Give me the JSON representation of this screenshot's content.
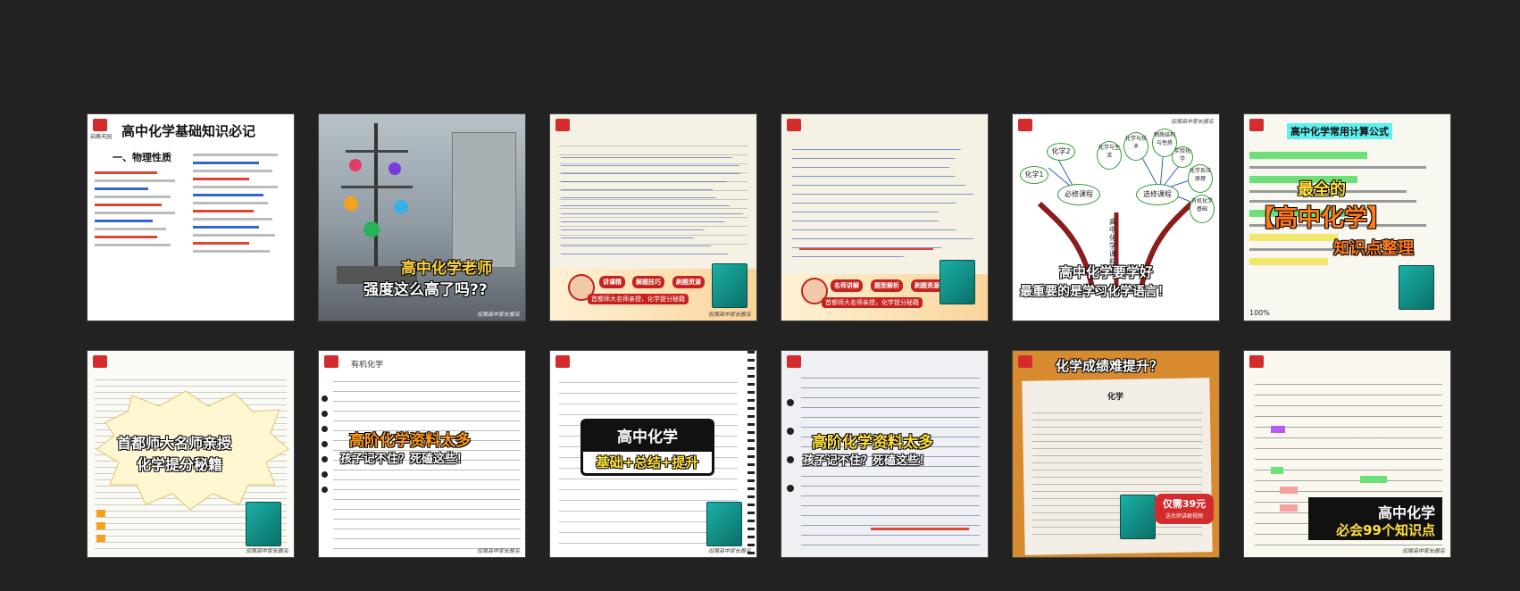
{
  "thumbnails": [
    {
      "title": "高中化学基础知识必记",
      "subtitle": "一、物理性质",
      "brand": "启峰天园"
    },
    {
      "overlay_line1": "高中化学老师",
      "overlay_line2": "强度这么高了吗??",
      "footer": "仅限高中家长报名"
    },
    {
      "tags": [
        "讲课精",
        "解题技巧",
        "刷题资源"
      ],
      "promo_line": "首都师大名师亲授，化学提分秘籍",
      "footer": "仅限高中家长报名"
    },
    {
      "tags": [
        "名师讲解",
        "题型解析",
        "刷题资源"
      ],
      "promo_line": "首都师大名师亲授，化学提分秘籍"
    },
    {
      "trunk_label": "高中化学课程",
      "left_branch": "必修课程",
      "right_branch": "选修课程",
      "nodes": [
        "化学1",
        "化学2",
        "化学与生活",
        "化学与技术",
        "物质结构与性质",
        "化学反应原理",
        "有机化学基础",
        "实验化学"
      ],
      "caption_line1": "高中化学要学好",
      "caption_line2": "最重要的是学习化学语言！",
      "footer": "仅限高中家长报名"
    },
    {
      "header": "高中化学常用计算公式",
      "headline_1": "最全的",
      "headline_2": "【高中化学】",
      "headline_3": "知识点整理",
      "percent": "100%"
    },
    {
      "banner_line1": "首都师大名师亲授",
      "banner_line2": "化学提分秘籍",
      "footer": "仅限高中家长报名"
    },
    {
      "overlay_line1": "高阶化学资料太多",
      "overlay_line2": "孩子记不住？死磕这些！",
      "heading": "有机化学",
      "footer": "仅限高中家长报名"
    },
    {
      "box_title": "高中化学",
      "box_subtitle": "基础+总结+提升",
      "footer": "仅限高中家长报名"
    },
    {
      "overlay_line1": "高阶化学资料太多",
      "overlay_line2": "孩子记不住？死磕这些！"
    },
    {
      "header": "化学成绩难提升？",
      "price_tag": "仅需39元",
      "price_sub": "送名师讲解视频",
      "exam_title": "化学"
    },
    {
      "box_line1": "高中化学",
      "box_line2": "必会99个知识点",
      "footer": "仅限高中家长报名"
    }
  ]
}
